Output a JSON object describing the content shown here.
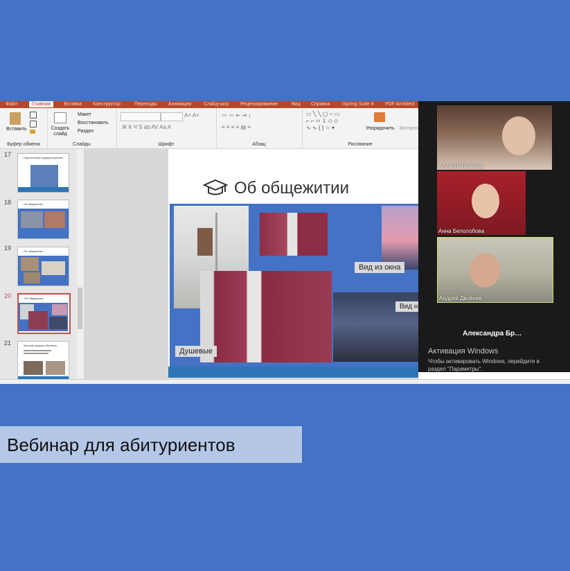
{
  "ribbon": {
    "tabs": [
      "Файл",
      "Главная",
      "Вставка",
      "Конструктор",
      "Переходы",
      "Анимация",
      "Слайд-шоу",
      "Рецензирование",
      "Вид",
      "Справка",
      "iSpring Suite 9",
      "PDF Architect"
    ],
    "active_tab": "Главная",
    "clipboard": {
      "paste_label": "Вставить",
      "group_label": "Буфер обмена"
    },
    "slides": {
      "new_slide_label": "Создать слайд",
      "layout_label": "Макет",
      "reset_label": "Восстановить",
      "section_label": "Раздел",
      "group_label": "Слайды"
    },
    "font": {
      "group_label": "Шрифт"
    },
    "paragraph": {
      "group_label": "Абзац"
    },
    "drawing": {
      "arrange_label": "Упорядочить",
      "quick_styles_label": "Экспресс-стили",
      "group_label": "Рисование"
    }
  },
  "thumbnails": [
    {
      "number": "17",
      "title": "Перспективы трудоустройства",
      "current": false
    },
    {
      "number": "18",
      "title": "Об общежитии",
      "current": false
    },
    {
      "number": "19",
      "title": "Об общежитии",
      "current": false
    },
    {
      "number": "20",
      "title": "Об общежитии",
      "current": true
    },
    {
      "number": "21",
      "title": "Заочная форма обучения",
      "current": false
    }
  ],
  "slide": {
    "title": "Об общежитии",
    "labels": {
      "window_view_1": "Вид из окна",
      "window_view_2": "Вид н",
      "showers": "Душевые"
    }
  },
  "zoom": {
    "participants": [
      {
        "name": "Алексей Яковлев"
      },
      {
        "name": "Анна Белолобова"
      },
      {
        "name": "Андрей Двойнев"
      }
    ],
    "name_only": "Александра  Бр…",
    "activation_title": "Активация Windows",
    "activation_line1": "Чтобы активировать Windows, перейдите в",
    "activation_line2": "раздел \"Параметры\"."
  },
  "banner": {
    "text": "Вебинар для абитуриентов"
  },
  "colors": {
    "background": "#4472c4",
    "banner": "#b4c7e7",
    "ribbon": "#b7472a",
    "slide_blue": "#4472c4",
    "current_thumb": "#c0504d"
  }
}
